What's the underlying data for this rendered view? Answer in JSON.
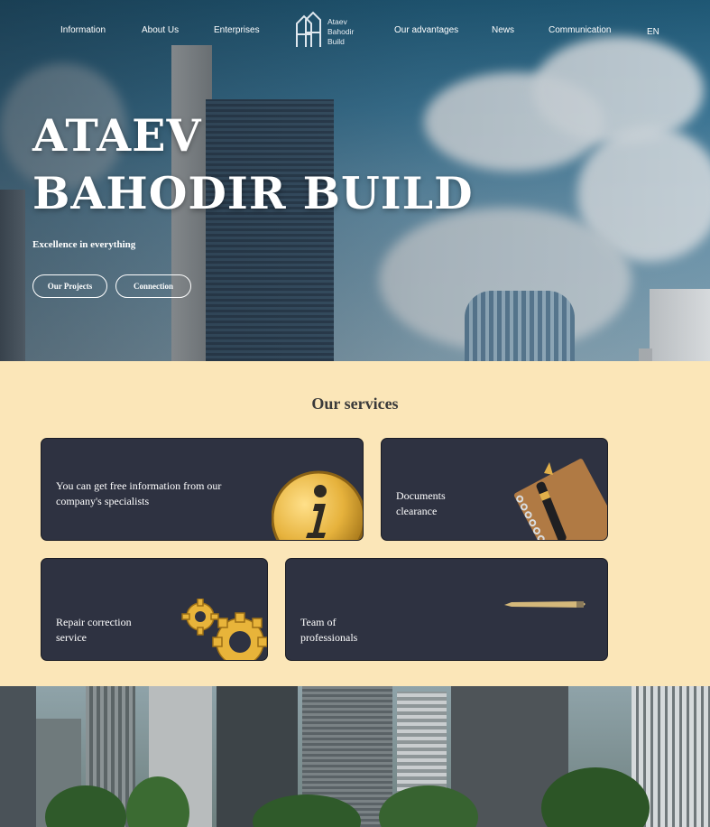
{
  "nav": {
    "items": [
      "Information",
      "About Us",
      "Enterprises",
      "Our advantages",
      "News",
      "Communication"
    ],
    "language": "EN",
    "logo": {
      "line1": "Ataev",
      "line2": "Bahodir",
      "line3": "Build"
    }
  },
  "hero": {
    "title_line1": "ATAEV",
    "title_line2": "BAHODIR BUILD",
    "subtitle": "Excellence in everything",
    "btn_projects": "Our Projects",
    "btn_connection": "Connection"
  },
  "services": {
    "title": "Our services",
    "cards": [
      {
        "text": "You can get free information from our company's specialists",
        "art": "info-coin-icon"
      },
      {
        "text": "Documents clearance",
        "art": "notebook-pen-icon"
      },
      {
        "text": "Repair correction service",
        "art": "gears-icon"
      },
      {
        "text": "Team of professionals",
        "art": "pencil-icon"
      }
    ]
  },
  "colors": {
    "services_bg": "#fbe6b8",
    "card_bg": "#2e3241",
    "accent_gold": "#e8b43a"
  }
}
